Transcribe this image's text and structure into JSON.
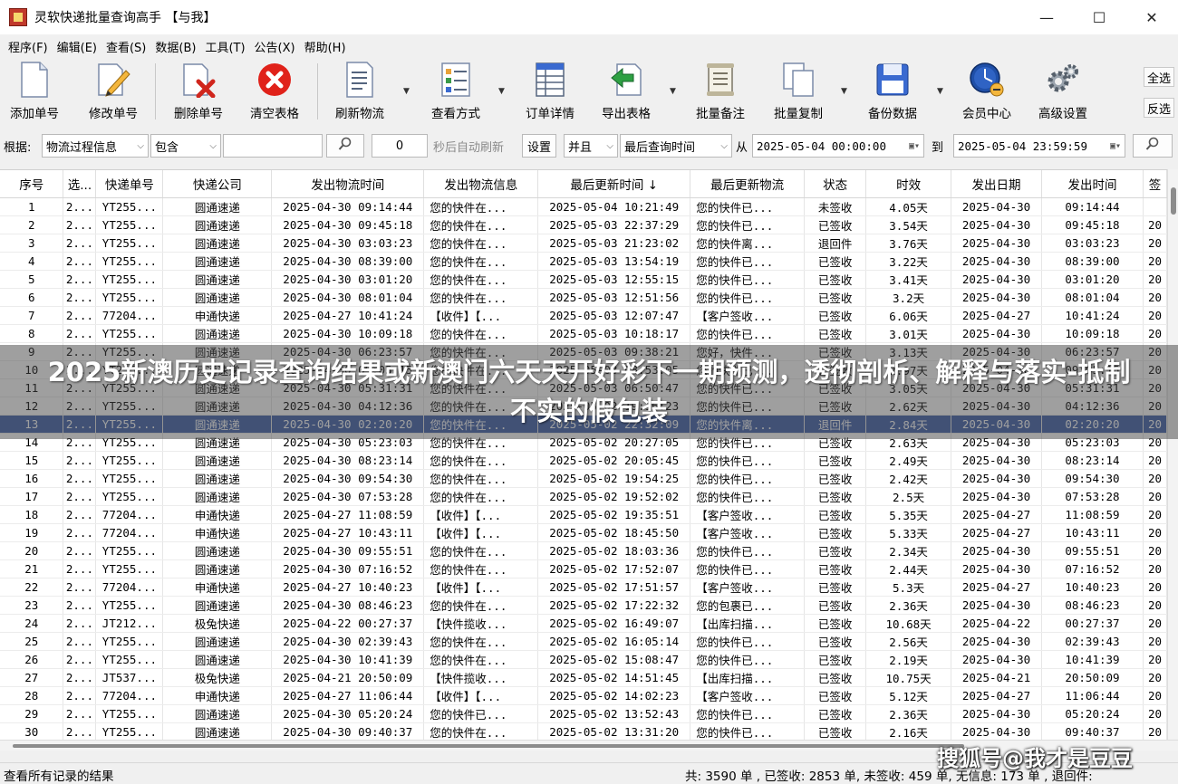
{
  "window": {
    "title": "灵软快递批量查询高手 【与我】",
    "controls": {
      "minimize": "—",
      "maximize": "☐",
      "close": "✕"
    }
  },
  "menu": [
    "程序(F)",
    "编辑(E)",
    "查看(S)",
    "数据(B)",
    "工具(T)",
    "公告(X)",
    "帮助(H)"
  ],
  "toolbar": {
    "add": "添加单号",
    "edit": "修改单号",
    "delete": "删除单号",
    "clear": "清空表格",
    "refresh": "刷新物流",
    "view_mode": "查看方式",
    "order_detail": "订单详情",
    "export": "导出表格",
    "batch_note": "批量备注",
    "batch_copy": "批量复制",
    "backup": "备份数据",
    "member": "会员中心",
    "advanced": "高级设置",
    "select_all": "全选",
    "invert": "反选"
  },
  "filter": {
    "by_label": "根据:",
    "field": "物流过程信息",
    "op": "包含",
    "keyword": "",
    "interval": "0",
    "auto_refresh": "秒后自动刷新",
    "settings": "设置",
    "logic": "并且",
    "time_field": "最后查询时间",
    "from": "从",
    "from_value": "2025-05-04 00:00:00",
    "to": "到",
    "to_value": "2025-05-04 23:59:59"
  },
  "table": {
    "headers": [
      "序号",
      "选...",
      "快递单号",
      "快递公司",
      "发出物流时间",
      "发出物流信息",
      "最后更新时间 ↓",
      "最后更新物流",
      "状态",
      "时效",
      "发出日期",
      "发出时间",
      "签"
    ],
    "selected_row": 12,
    "rows": [
      [
        "1",
        "2...",
        "YT255...",
        "圆通速递",
        "2025-04-30 09:14:44",
        "您的快件在...",
        "2025-05-04 10:21:49",
        "您的快件已...",
        "未签收",
        "4.05天",
        "2025-04-30",
        "09:14:44",
        ""
      ],
      [
        "2",
        "2...",
        "YT255...",
        "圆通速递",
        "2025-04-30 09:45:18",
        "您的快件在...",
        "2025-05-03 22:37:29",
        "您的快件已...",
        "已签收",
        "3.54天",
        "2025-04-30",
        "09:45:18",
        "20"
      ],
      [
        "3",
        "2...",
        "YT255...",
        "圆通速递",
        "2025-04-30 03:03:23",
        "您的快件在...",
        "2025-05-03 21:23:02",
        "您的快件离...",
        "退回件",
        "3.76天",
        "2025-04-30",
        "03:03:23",
        "20"
      ],
      [
        "4",
        "2...",
        "YT255...",
        "圆通速递",
        "2025-04-30 08:39:00",
        "您的快件在...",
        "2025-05-03 13:54:19",
        "您的快件已...",
        "已签收",
        "3.22天",
        "2025-04-30",
        "08:39:00",
        "20"
      ],
      [
        "5",
        "2...",
        "YT255...",
        "圆通速递",
        "2025-04-30 03:01:20",
        "您的快件在...",
        "2025-05-03 12:55:15",
        "您的快件已...",
        "已签收",
        "3.41天",
        "2025-04-30",
        "03:01:20",
        "20"
      ],
      [
        "6",
        "2...",
        "YT255...",
        "圆通速递",
        "2025-04-30 08:01:04",
        "您的快件在...",
        "2025-05-03 12:51:56",
        "您的快件已...",
        "已签收",
        "3.2天",
        "2025-04-30",
        "08:01:04",
        "20"
      ],
      [
        "7",
        "2...",
        "77204...",
        "申通快递",
        "2025-04-27 10:41:24",
        "【收件】【...",
        "2025-05-03 12:07:47",
        "【客户签收...",
        "已签收",
        "6.06天",
        "2025-04-27",
        "10:41:24",
        "20"
      ],
      [
        "8",
        "2...",
        "YT255...",
        "圆通速递",
        "2025-04-30 10:09:18",
        "您的快件在...",
        "2025-05-03 10:18:17",
        "您的快件已...",
        "已签收",
        "3.01天",
        "2025-04-30",
        "10:09:18",
        "20"
      ],
      [
        "9",
        "2...",
        "YT255...",
        "圆通速递",
        "2025-04-30 06:23:57",
        "您的快件在...",
        "2025-05-03 09:38:21",
        "您好，快件...",
        "已签收",
        "3.13天",
        "2025-04-30",
        "06:23:57",
        "20"
      ],
      [
        "10",
        "2...",
        "YT255...",
        "圆通速递",
        "2025-04-30 09:05:15",
        "您的快件在...",
        "2025-05-03 08:53:05",
        "您的快件已...",
        "已签收",
        "2.97天",
        "2025-04-30",
        "09:05:15",
        "20"
      ],
      [
        "11",
        "2...",
        "YT255...",
        "圆通速递",
        "2025-04-30 05:31:31",
        "您的快件在...",
        "2025-05-03 06:50:47",
        "您的快件已...",
        "已签收",
        "3.05天",
        "2025-04-30",
        "05:31:31",
        "20"
      ],
      [
        "12",
        "2...",
        "YT255...",
        "圆通速递",
        "2025-04-30 04:12:36",
        "您的快件在...",
        "2025-05-02 19:16:23",
        "您的快件已...",
        "已签收",
        "2.62天",
        "2025-04-30",
        "04:12:36",
        "20"
      ],
      [
        "13",
        "2...",
        "YT255...",
        "圆通速递",
        "2025-04-30 02:20:20",
        "您的快件在...",
        "2025-05-02 22:32:09",
        "您的快件离...",
        "退回件",
        "2.84天",
        "2025-04-30",
        "02:20:20",
        "20"
      ],
      [
        "14",
        "2...",
        "YT255...",
        "圆通速递",
        "2025-04-30 05:23:03",
        "您的快件在...",
        "2025-05-02 20:27:05",
        "您的快件已...",
        "已签收",
        "2.63天",
        "2025-04-30",
        "05:23:03",
        "20"
      ],
      [
        "15",
        "2...",
        "YT255...",
        "圆通速递",
        "2025-04-30 08:23:14",
        "您的快件在...",
        "2025-05-02 20:05:45",
        "您的快件已...",
        "已签收",
        "2.49天",
        "2025-04-30",
        "08:23:14",
        "20"
      ],
      [
        "16",
        "2...",
        "YT255...",
        "圆通速递",
        "2025-04-30 09:54:30",
        "您的快件在...",
        "2025-05-02 19:54:25",
        "您的快件已...",
        "已签收",
        "2.42天",
        "2025-04-30",
        "09:54:30",
        "20"
      ],
      [
        "17",
        "2...",
        "YT255...",
        "圆通速递",
        "2025-04-30 07:53:28",
        "您的快件在...",
        "2025-05-02 19:52:02",
        "您的快件已...",
        "已签收",
        "2.5天",
        "2025-04-30",
        "07:53:28",
        "20"
      ],
      [
        "18",
        "2...",
        "77204...",
        "申通快递",
        "2025-04-27 11:08:59",
        "【收件】【...",
        "2025-05-02 19:35:51",
        "【客户签收...",
        "已签收",
        "5.35天",
        "2025-04-27",
        "11:08:59",
        "20"
      ],
      [
        "19",
        "2...",
        "77204...",
        "申通快递",
        "2025-04-27 10:43:11",
        "【收件】【...",
        "2025-05-02 18:45:50",
        "【客户签收...",
        "已签收",
        "5.33天",
        "2025-04-27",
        "10:43:11",
        "20"
      ],
      [
        "20",
        "2...",
        "YT255...",
        "圆通速递",
        "2025-04-30 09:55:51",
        "您的快件在...",
        "2025-05-02 18:03:36",
        "您的快件已...",
        "已签收",
        "2.34天",
        "2025-04-30",
        "09:55:51",
        "20"
      ],
      [
        "21",
        "2...",
        "YT255...",
        "圆通速递",
        "2025-04-30 07:16:52",
        "您的快件在...",
        "2025-05-02 17:52:07",
        "您的快件已...",
        "已签收",
        "2.44天",
        "2025-04-30",
        "07:16:52",
        "20"
      ],
      [
        "22",
        "2...",
        "77204...",
        "申通快递",
        "2025-04-27 10:40:23",
        "【收件】【...",
        "2025-05-02 17:51:57",
        "【客户签收...",
        "已签收",
        "5.3天",
        "2025-04-27",
        "10:40:23",
        "20"
      ],
      [
        "23",
        "2...",
        "YT255...",
        "圆通速递",
        "2025-04-30 08:46:23",
        "您的快件在...",
        "2025-05-02 17:22:32",
        "您的包裹已...",
        "已签收",
        "2.36天",
        "2025-04-30",
        "08:46:23",
        "20"
      ],
      [
        "24",
        "2...",
        "JT212...",
        "极兔快递",
        "2025-04-22 00:27:37",
        "【快件揽收...",
        "2025-05-02 16:49:07",
        "【出库扫描...",
        "已签收",
        "10.68天",
        "2025-04-22",
        "00:27:37",
        "20"
      ],
      [
        "25",
        "2...",
        "YT255...",
        "圆通速递",
        "2025-04-30 02:39:43",
        "您的快件在...",
        "2025-05-02 16:05:14",
        "您的快件已...",
        "已签收",
        "2.56天",
        "2025-04-30",
        "02:39:43",
        "20"
      ],
      [
        "26",
        "2...",
        "YT255...",
        "圆通速递",
        "2025-04-30 10:41:39",
        "您的快件在...",
        "2025-05-02 15:08:47",
        "您的快件已...",
        "已签收",
        "2.19天",
        "2025-04-30",
        "10:41:39",
        "20"
      ],
      [
        "27",
        "2...",
        "JT537...",
        "极兔快递",
        "2025-04-21 20:50:09",
        "【快件揽收...",
        "2025-05-02 14:51:45",
        "【出库扫描...",
        "已签收",
        "10.75天",
        "2025-04-21",
        "20:50:09",
        "20"
      ],
      [
        "28",
        "2...",
        "77204...",
        "申通快递",
        "2025-04-27 11:06:44",
        "【收件】【...",
        "2025-05-02 14:02:23",
        "【客户签收...",
        "已签收",
        "5.12天",
        "2025-04-27",
        "11:06:44",
        "20"
      ],
      [
        "29",
        "2...",
        "YT255...",
        "圆通速递",
        "2025-04-30 05:20:24",
        "您的快件已...",
        "2025-05-02 13:52:43",
        "您的快件已...",
        "已签收",
        "2.36天",
        "2025-04-30",
        "05:20:24",
        "20"
      ],
      [
        "30",
        "2...",
        "YT255...",
        "圆通速递",
        "2025-04-30 09:40:37",
        "您的快件在...",
        "2025-05-02 13:31:20",
        "您的快件已...",
        "已签收",
        "2.16天",
        "2025-04-30",
        "09:40:37",
        "20"
      ]
    ]
  },
  "status": {
    "left": "查看所有记录的结果",
    "right": "共: 3590 单 , 已签收:  2853 单, 未签收:  459 单, 无信息: 173 单 , 退回件:"
  },
  "overlay": {
    "headline": "2025新澳历史记录查询结果或新澳门六天天开好彩下一期预测，透彻剖析、解释与落实-抵制不实的假包装",
    "watermark": "搜狐号@我才是豆豆"
  }
}
